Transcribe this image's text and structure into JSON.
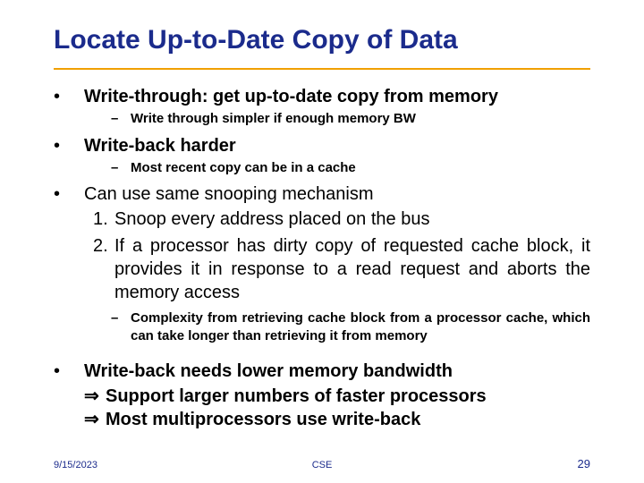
{
  "title": "Locate Up-to-Date Copy of Data",
  "bullets": {
    "b1": {
      "mark": "•",
      "text": "Write-through: get up-to-date copy from memory",
      "sub": {
        "dash": "–",
        "text": "Write through simpler if enough memory BW"
      }
    },
    "b2": {
      "mark": "•",
      "text": "Write-back harder",
      "sub": {
        "dash": "–",
        "text": "Most recent copy can be in a cache"
      }
    },
    "b3": {
      "mark": "•",
      "text": "Can use same snooping mechanism",
      "items": {
        "n1": {
          "num": "1.",
          "text": "Snoop every address placed on the bus"
        },
        "n2": {
          "num": "2.",
          "text": "If a processor has dirty copy of requested cache block, it provides it in response to a read request and aborts the memory access"
        }
      },
      "sub": {
        "dash": "–",
        "text": "Complexity from retrieving cache block from a processor cache, which can take longer than retrieving it from memory"
      }
    },
    "b4": {
      "mark": "•",
      "text": "Write-back needs lower memory bandwidth",
      "arrow1": {
        "sym": "⇒",
        "text": "Support larger numbers of faster processors"
      },
      "arrow2": {
        "sym": "⇒",
        "text": "Most multiprocessors use write-back"
      }
    }
  },
  "footer": {
    "date": "9/15/2023",
    "center": "CSE",
    "page": "29"
  }
}
